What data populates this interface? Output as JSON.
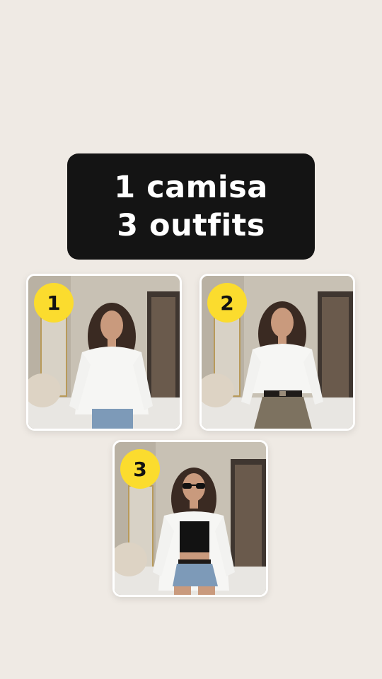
{
  "title": {
    "line1": "1 camisa",
    "line2": "3 outfits"
  },
  "outfits": [
    {
      "number": "1",
      "top": "white oversized shirt",
      "bottom": "denim jeans"
    },
    {
      "number": "2",
      "top": "white oversized shirt",
      "bottom": "brown mini skirt with black belt"
    },
    {
      "number": "3",
      "top": "white shirt over black tube top, sunglasses",
      "bottom": "denim shorts"
    }
  ],
  "colors": {
    "background": "#efeae4",
    "title_box": "#141414",
    "title_text": "#ffffff",
    "badge": "#fbdc2e",
    "card_border": "#ffffff"
  }
}
